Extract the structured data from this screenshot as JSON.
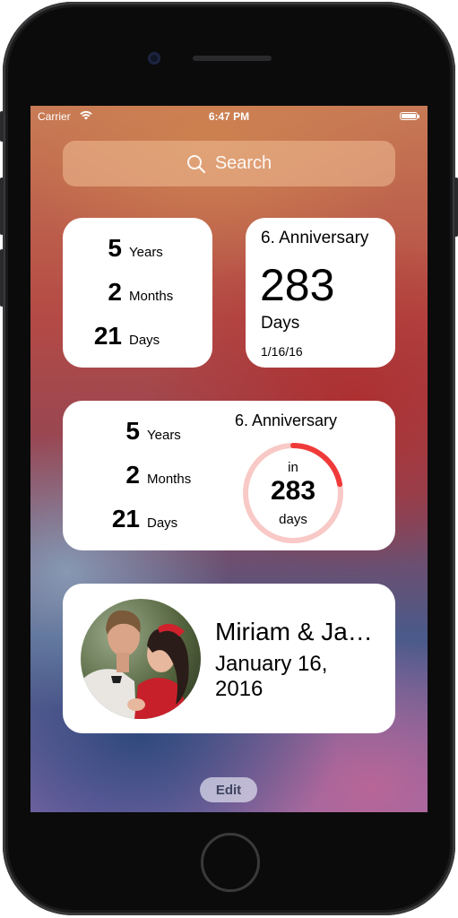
{
  "status_bar": {
    "carrier": "Carrier",
    "time": "6:47 PM"
  },
  "search": {
    "label": "Search"
  },
  "widget_small_countup": {
    "rows": [
      {
        "value": "5",
        "unit": "Years"
      },
      {
        "value": "2",
        "unit": "Months"
      },
      {
        "value": "21",
        "unit": "Days"
      }
    ]
  },
  "widget_small_anniversary": {
    "title": "6.  Anniversary",
    "count": "283",
    "unit": "Days",
    "date": "1/16/16"
  },
  "widget_medium": {
    "rows": [
      {
        "value": "5",
        "unit": "Years"
      },
      {
        "value": "2",
        "unit": "Months"
      },
      {
        "value": "21",
        "unit": "Days"
      }
    ],
    "title": "6. Anniversary",
    "ring_prefix": "in",
    "ring_count": "283",
    "ring_unit": "days",
    "ring_progress": 0.22,
    "ring_color": "#f03a3a",
    "ring_track_color": "#f8c9c6"
  },
  "widget_photo": {
    "name": "Miriam & Ja…",
    "date_line1": "January 16,",
    "date_line2": "2016"
  },
  "edit_button": {
    "label": "Edit"
  }
}
